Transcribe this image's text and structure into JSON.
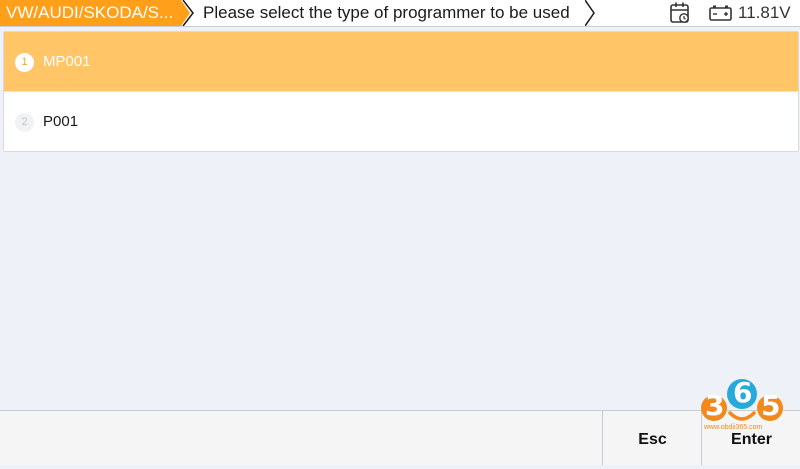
{
  "header": {
    "breadcrumb": "VW/AUDI/SKODA/S...",
    "title": "Please select the type of programmer to be used",
    "calendar_icon": "calendar-icon",
    "battery_icon": "battery-icon",
    "voltage": "11.81V",
    "accent_color": "#ff9f1a"
  },
  "list": {
    "selected_color": "#ffc567",
    "items": [
      {
        "number": "1",
        "label": "MP001",
        "selected": true
      },
      {
        "number": "2",
        "label": "P001",
        "selected": false
      }
    ]
  },
  "footer": {
    "esc_label": "Esc",
    "enter_label": "Enter"
  },
  "watermark": {
    "digits": [
      "3",
      "6",
      "5"
    ],
    "site": "www.obdii365.com"
  }
}
